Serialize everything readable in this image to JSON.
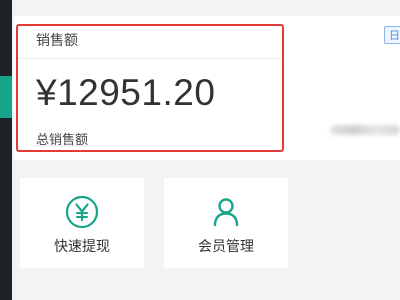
{
  "sales": {
    "title": "销售额",
    "amount": "¥12951.20",
    "sub_label": "总销售额"
  },
  "corner_tag": "日",
  "quick_actions": [
    {
      "label": "快速提现",
      "icon": "yen-coin-icon"
    },
    {
      "label": "会员管理",
      "icon": "user-icon"
    }
  ],
  "colors": {
    "accent": "#17a589",
    "highlight_border": "#e53935",
    "sidebar": "#1f2227"
  }
}
